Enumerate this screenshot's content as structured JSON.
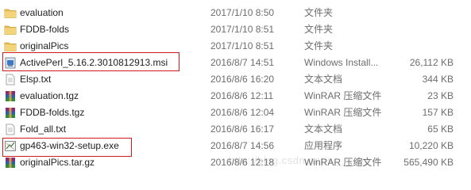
{
  "files": [
    {
      "name": "evaluation",
      "date": "2017/1/10 8:50",
      "type": "文件夹",
      "size": "",
      "icon": "folder-icon"
    },
    {
      "name": "FDDB-folds",
      "date": "2017/1/10 8:51",
      "type": "文件夹",
      "size": "",
      "icon": "folder-icon"
    },
    {
      "name": "originalPics",
      "date": "2017/1/10 8:51",
      "type": "文件夹",
      "size": "",
      "icon": "folder-icon"
    },
    {
      "name": "ActivePerl_5.16.2.3010812913.msi",
      "date": "2016/8/7 14:51",
      "type": "Windows Install...",
      "size": "26,112 KB",
      "icon": "msi-installer-icon"
    },
    {
      "name": "Elsp.txt",
      "date": "2016/8/6 16:20",
      "type": "文本文档",
      "size": "344 KB",
      "icon": "text-file-icon"
    },
    {
      "name": "evaluation.tgz",
      "date": "2016/8/6 12:11",
      "type": "WinRAR 压缩文件",
      "size": "23 KB",
      "icon": "winrar-archive-icon"
    },
    {
      "name": "FDDB-folds.tgz",
      "date": "2016/8/6 12:04",
      "type": "WinRAR 压缩文件",
      "size": "157 KB",
      "icon": "winrar-archive-icon"
    },
    {
      "name": "Fold_all.txt",
      "date": "2016/8/6 16:17",
      "type": "文本文档",
      "size": "65 KB",
      "icon": "text-file-icon"
    },
    {
      "name": "gp463-win32-setup.exe",
      "date": "2016/8/7 14:56",
      "type": "应用程序",
      "size": "10,220 KB",
      "icon": "exe-application-icon"
    },
    {
      "name": "originalPics.tar.gz",
      "date": "2016/8/6 12:18",
      "type": "WinRAR 压缩文件",
      "size": "565,490 KB",
      "icon": "winrar-archive-icon"
    }
  ],
  "highlight_color": "#d11b1b",
  "watermark": "http://blog.csdn.net/s____by"
}
